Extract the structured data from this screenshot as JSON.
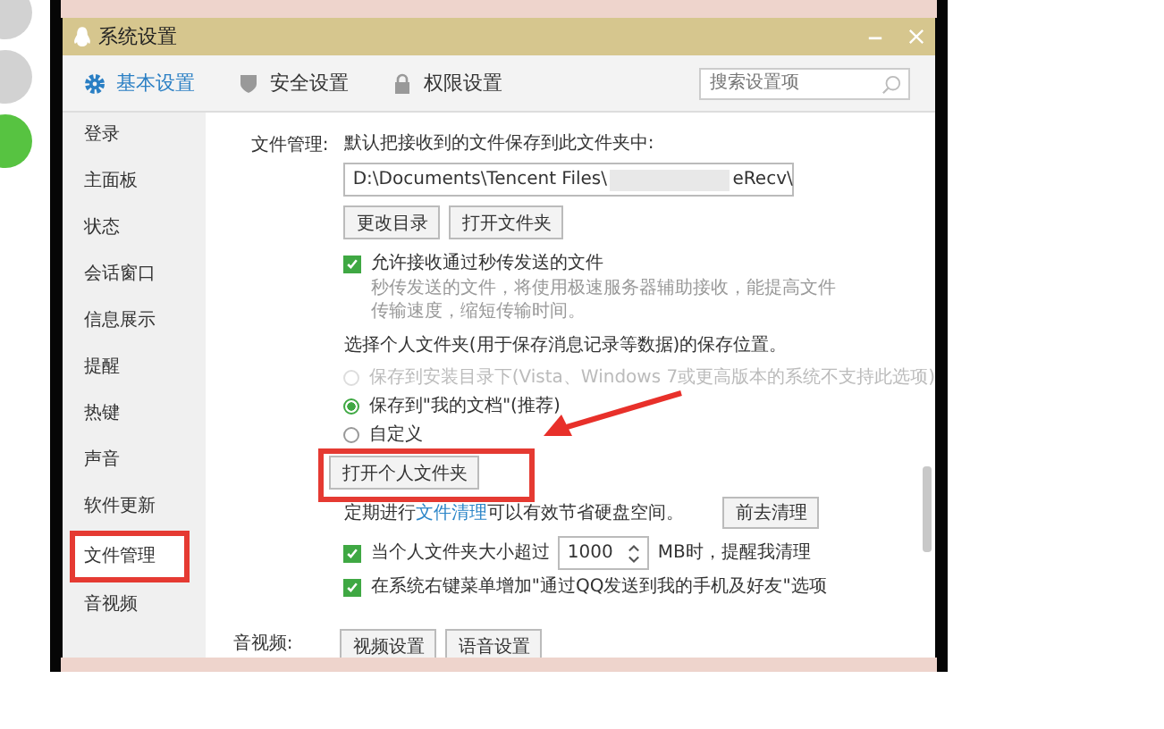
{
  "window": {
    "title": "系统设置"
  },
  "tabs": [
    {
      "label": "基本设置",
      "selected": true
    },
    {
      "label": "安全设置",
      "selected": false
    },
    {
      "label": "权限设置",
      "selected": false
    }
  ],
  "search": {
    "placeholder": "搜索设置项"
  },
  "sidebar": {
    "items": [
      {
        "label": "登录",
        "selected": false
      },
      {
        "label": "主面板",
        "selected": false
      },
      {
        "label": "状态",
        "selected": false
      },
      {
        "label": "会话窗口",
        "selected": false
      },
      {
        "label": "信息展示",
        "selected": false
      },
      {
        "label": "提醒",
        "selected": false
      },
      {
        "label": "热键",
        "selected": false
      },
      {
        "label": "声音",
        "selected": false
      },
      {
        "label": "软件更新",
        "selected": false
      },
      {
        "label": "文件管理",
        "selected": true
      },
      {
        "label": "音视频",
        "selected": false
      }
    ]
  },
  "file_management": {
    "label": "文件管理:",
    "intro": "默认把接收到的文件保存到此文件夹中:",
    "path_start": "D:\\Documents\\Tencent Files\\",
    "path_end": "eRecv\\",
    "buttons": [
      "更改目录",
      "打开文件夹"
    ],
    "flash_transfer": {
      "label": "允许接收通过秒传发送的文件",
      "checked": true,
      "description": "秒传发送的文件，将使用极速服务器辅助接收，能提高文件传输速度，缩短传输时间。"
    },
    "personal_folder_heading": "选择个人文件夹(用于保存消息记录等数据)的保存位置。",
    "locations": [
      {
        "label": "保存到安装目录下(Vista、Windows 7或更高版本的系统不支持此选项)",
        "selected": false,
        "disabled": true
      },
      {
        "label": "保存到\"我的文档\"(推荐)",
        "selected": true,
        "disabled": false
      },
      {
        "label": "自定义",
        "selected": false,
        "disabled": false
      }
    ],
    "open_personal_button": "打开个人文件夹",
    "cleanup": {
      "before": "定期进行",
      "link": "文件清理",
      "after": "可以有效节省硬盘空间。",
      "button": "前去清理"
    },
    "options": [
      {
        "kind": "size",
        "before": "当个人文件夹大小超过",
        "value": "1000",
        "after": "MB时，提醒我清理",
        "checked": true
      },
      {
        "kind": "plain",
        "label": "在系统右键菜单增加\"通过QQ发送到我的手机及好友\"选项",
        "checked": true
      }
    ]
  },
  "audio_video": {
    "label": "音视频:",
    "buttons": [
      "视频设置",
      "语音设置"
    ]
  }
}
